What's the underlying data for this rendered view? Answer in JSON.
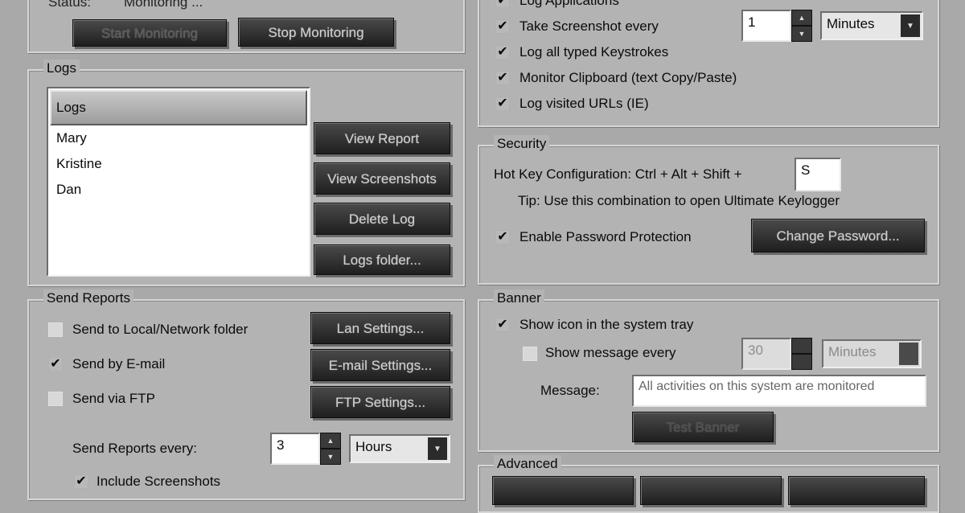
{
  "status": {
    "label": "Status:",
    "value": "Monitoring ...",
    "start_button": "Start Monitoring",
    "stop_button": "Stop Monitoring"
  },
  "logs": {
    "title": "Logs",
    "column_header": "Logs",
    "items": [
      "Mary",
      "Kristine",
      "Dan"
    ],
    "view_report": "View Report",
    "view_screenshots": "View Screenshots",
    "delete_log": "Delete Log",
    "logs_folder": "Logs folder..."
  },
  "send_reports": {
    "title": "Send Reports",
    "local_folder": {
      "label": "Send to Local/Network folder",
      "checked": false
    },
    "email": {
      "label": "Send by E-mail",
      "checked": true
    },
    "ftp": {
      "label": "Send via FTP",
      "checked": false
    },
    "lan_settings": "Lan Settings...",
    "email_settings": "E-mail Settings...",
    "ftp_settings": "FTP Settings...",
    "every_label": "Send Reports every:",
    "every_value": "3",
    "every_unit": "Hours",
    "include_screenshots": {
      "label": "Include Screenshots",
      "checked": true
    }
  },
  "monitoring_options": {
    "log_applications": {
      "label": "Log Applications",
      "checked": true
    },
    "take_screenshot": {
      "label": "Take Screenshot every",
      "checked": true
    },
    "screenshot_value": "1",
    "screenshot_unit": "Minutes",
    "log_keystrokes": {
      "label": "Log all typed Keystrokes",
      "checked": true
    },
    "monitor_clipboard": {
      "label": "Monitor Clipboard (text Copy/Paste)",
      "checked": true
    },
    "log_urls": {
      "label": "Log visited URLs (IE)",
      "checked": true
    }
  },
  "security": {
    "title": "Security",
    "hotkey_label": "Hot Key Configuration:  Ctrl + Alt + Shift +",
    "hotkey_value": "S",
    "tip": "Tip: Use this combination to open Ultimate Keylogger",
    "password_protection": {
      "label": "Enable Password Protection",
      "checked": true
    },
    "change_password": "Change Password..."
  },
  "banner": {
    "title": "Banner",
    "show_icon": {
      "label": "Show icon in the system tray",
      "checked": true
    },
    "show_message": {
      "label": "Show message every",
      "checked": false
    },
    "message_every_value": "30",
    "message_every_unit": "Minutes",
    "message_label": "Message:",
    "message_value": "All activities on this system are monitored",
    "test_banner": "Test Banner"
  },
  "advanced": {
    "title": "Advanced"
  },
  "glyphs": {
    "check": "✔",
    "up": "▲",
    "down": "▼"
  }
}
